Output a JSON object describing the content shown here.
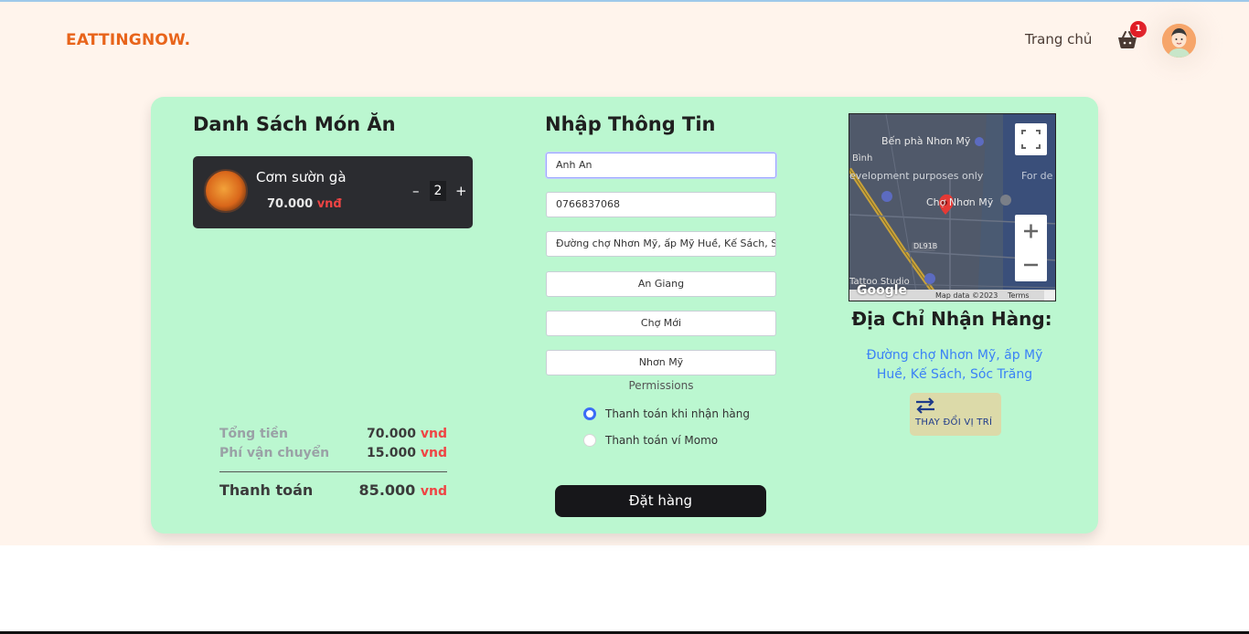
{
  "header": {
    "logo": "EATTINGNOW.",
    "nav_home": "Trang chủ",
    "cart_count": "1"
  },
  "cart": {
    "title": "Danh Sách Món Ăn",
    "items": [
      {
        "name": "Cơm sườn gà",
        "price": "70.000",
        "unit": "vnđ",
        "quantity": "2"
      }
    ],
    "subtotal_label": "Tổng tiền",
    "subtotal_value": "70.000",
    "shipping_label": "Phí vận chuyển",
    "shipping_value": "15.000",
    "total_label": "Thanh toán",
    "total_value": "85.000",
    "currency": "vnd"
  },
  "form": {
    "title": "Nhập Thông Tin",
    "name": "Anh An",
    "phone": "0766837068",
    "address": "Đường chợ Nhơn Mỹ, ấp Mỹ Huề, Kế Sách, Sóc Trăng",
    "province": "An Giang",
    "district": "Chợ Mới",
    "ward": "Nhơn Mỹ",
    "permissions_label": "Permissions",
    "payment_cod": "Thanh toán khi nhận hàng",
    "payment_momo": "Thanh toán ví Momo",
    "submit": "Đặt hàng"
  },
  "delivery": {
    "map_labels": {
      "ferry": "Bến phà Nhơn Mỹ",
      "dev": "evelopment purposes only",
      "dev2": "For de",
      "market": "Chợ Nhơn Mỹ",
      "binh": "Bình",
      "road": "DL91B",
      "tattoo": "Tattoo Studio",
      "google": "Google",
      "mapdata": "Map data ©2023",
      "terms": "Terms"
    },
    "title": "Địa Chỉ Nhận Hàng:",
    "address": "Đường chợ Nhơn Mỹ, ấp Mỹ Huề, Kế Sách, Sóc Trăng",
    "change_button": "THAY ĐỔI VỊ TRÍ"
  }
}
